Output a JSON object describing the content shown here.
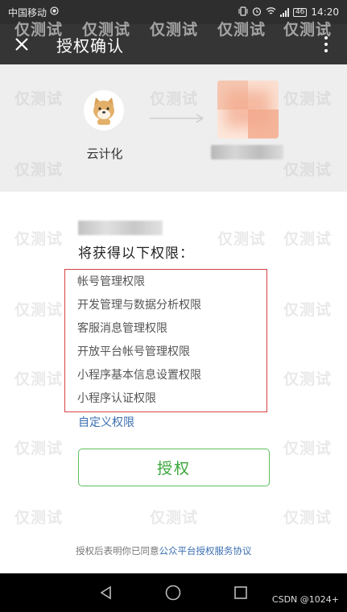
{
  "status": {
    "carrier": "中国移动",
    "battery": "46",
    "time": "14:20"
  },
  "header": {
    "title": "授权确认"
  },
  "app": {
    "name": "云计化"
  },
  "permissions": {
    "heading": "将获得以下权限：",
    "items": [
      "帐号管理权限",
      "开发管理与数据分析权限",
      "客服消息管理权限",
      "开放平台帐号管理权限",
      "小程序基本信息设置权限",
      "小程序认证权限"
    ],
    "custom_link": "自定义权限"
  },
  "actions": {
    "authorize_label": "授权"
  },
  "footer": {
    "prefix": "授权后表明你已同意",
    "agreement_link": "公众平台授权服务协议"
  },
  "watermark": {
    "text": "仅测试",
    "corner": "CSDN @1024+"
  },
  "colors": {
    "header_bg": "#353535",
    "highlight_border": "#d64141",
    "accent_green": "#3aa63a",
    "link_blue": "#3a6fb0"
  }
}
